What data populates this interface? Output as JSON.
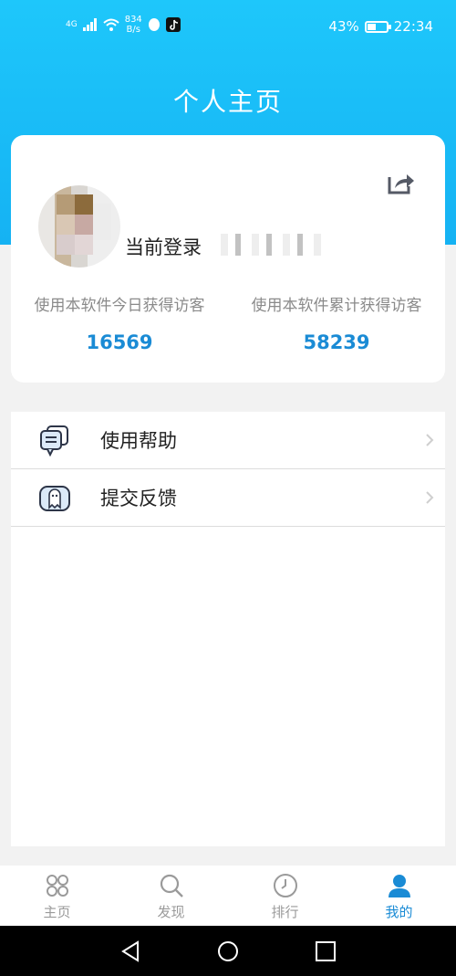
{
  "status_bar": {
    "network_type": "4G",
    "net_speed_value": "834",
    "net_speed_unit": "B/s",
    "battery_percent": "43%",
    "time": "22:34"
  },
  "header": {
    "title": "个人主页"
  },
  "profile": {
    "login_label": "当前登录",
    "stats": [
      {
        "label": "使用本软件今日获得访客",
        "value": "16569"
      },
      {
        "label": "使用本软件累计获得访客",
        "value": "58239"
      }
    ]
  },
  "menu": {
    "items": [
      {
        "label": "使用帮助",
        "icon": "chat-bubbles-icon"
      },
      {
        "label": "提交反馈",
        "icon": "feedback-ghost-icon"
      }
    ]
  },
  "tabbar": {
    "tabs": [
      {
        "label": "主页",
        "icon": "four-circles-icon",
        "active": false
      },
      {
        "label": "发现",
        "icon": "search-icon",
        "active": false
      },
      {
        "label": "排行",
        "icon": "clock-icon",
        "active": false
      },
      {
        "label": "我的",
        "icon": "person-icon",
        "active": true
      }
    ]
  },
  "colors": {
    "header_blue": "#1ec7fb",
    "accent_blue": "#1a8bd5",
    "tab_inactive": "#9a9a9a",
    "background": "#f2f2f2"
  }
}
